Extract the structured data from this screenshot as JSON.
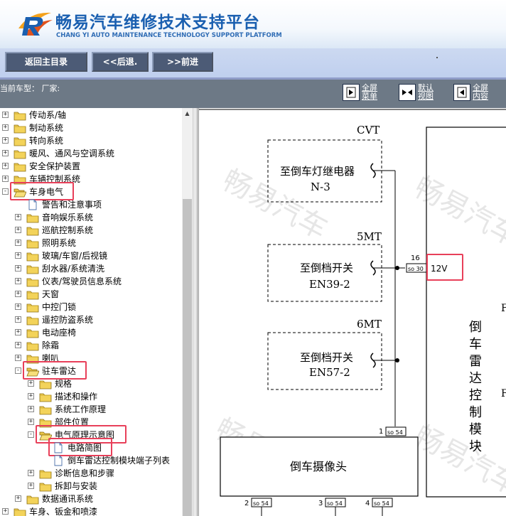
{
  "header": {
    "site_title": "畅易汽车维修技术支持平台",
    "site_subtitle": "CHANG YI AUTO MAINTENANCE TECHNOLOGY SUPPORT PLATFORM"
  },
  "toolbar": {
    "home_label": "返回主目录",
    "back_label": "<<后退.",
    "forward_label": ">>前进"
  },
  "infobar": {
    "current_model": "当前车型：  厂家:",
    "view_buttons": [
      {
        "line1": "全屏",
        "line2": "菜单"
      },
      {
        "line1": "默认",
        "line2": "视图"
      },
      {
        "line1": "全屏",
        "line2": "内容"
      }
    ]
  },
  "tree": {
    "items": [
      {
        "label": "传动系/轴",
        "depth": 0,
        "expand": "+",
        "icon": "folder-closed-icon"
      },
      {
        "label": "制动系统",
        "depth": 0,
        "expand": "+",
        "icon": "folder-closed-icon"
      },
      {
        "label": "转向系统",
        "depth": 0,
        "expand": "+",
        "icon": "folder-closed-icon"
      },
      {
        "label": "暖风、通风与空调系统",
        "depth": 0,
        "expand": "+",
        "icon": "folder-closed-icon"
      },
      {
        "label": "安全保护装置",
        "depth": 0,
        "expand": "+",
        "icon": "folder-closed-icon"
      },
      {
        "label": "车辆控制系统",
        "depth": 0,
        "expand": "+",
        "icon": "folder-closed-icon"
      },
      {
        "label": "车身电气",
        "depth": 0,
        "expand": "-",
        "icon": "folder-open-icon",
        "highlight": true
      },
      {
        "label": "警告和注意事项",
        "depth": 1,
        "expand": "",
        "icon": "document-icon"
      },
      {
        "label": "音响娱乐系统",
        "depth": 1,
        "expand": "+",
        "icon": "folder-closed-icon"
      },
      {
        "label": "巡航控制系统",
        "depth": 1,
        "expand": "+",
        "icon": "folder-closed-icon"
      },
      {
        "label": "照明系统",
        "depth": 1,
        "expand": "+",
        "icon": "folder-closed-icon"
      },
      {
        "label": "玻璃/车窗/后视镜",
        "depth": 1,
        "expand": "+",
        "icon": "folder-closed-icon"
      },
      {
        "label": "刮水器/系统清洗",
        "depth": 1,
        "expand": "+",
        "icon": "folder-closed-icon"
      },
      {
        "label": "仪表/驾驶员信息系统",
        "depth": 1,
        "expand": "+",
        "icon": "folder-closed-icon"
      },
      {
        "label": "天窗",
        "depth": 1,
        "expand": "+",
        "icon": "folder-closed-icon"
      },
      {
        "label": "中控门锁",
        "depth": 1,
        "expand": "+",
        "icon": "folder-closed-icon"
      },
      {
        "label": "遥控防盗系统",
        "depth": 1,
        "expand": "+",
        "icon": "folder-closed-icon"
      },
      {
        "label": "电动座椅",
        "depth": 1,
        "expand": "+",
        "icon": "folder-closed-icon"
      },
      {
        "label": "除霜",
        "depth": 1,
        "expand": "+",
        "icon": "folder-closed-icon"
      },
      {
        "label": "喇叭",
        "depth": 1,
        "expand": "+",
        "icon": "folder-closed-icon"
      },
      {
        "label": "驻车雷达",
        "depth": 1,
        "expand": "-",
        "icon": "folder-open-icon",
        "highlight": true
      },
      {
        "label": "规格",
        "depth": 2,
        "expand": "+",
        "icon": "folder-closed-icon"
      },
      {
        "label": "描述和操作",
        "depth": 2,
        "expand": "+",
        "icon": "folder-closed-icon"
      },
      {
        "label": "系统工作原理",
        "depth": 2,
        "expand": "+",
        "icon": "folder-closed-icon"
      },
      {
        "label": "部件位置",
        "depth": 2,
        "expand": "+",
        "icon": "folder-closed-icon"
      },
      {
        "label": "电气原理示意图",
        "depth": 2,
        "expand": "-",
        "icon": "folder-open-icon",
        "highlight": true
      },
      {
        "label": "电路简图",
        "depth": 3,
        "expand": "",
        "icon": "document-icon",
        "highlight": true
      },
      {
        "label": "倒车雷达控制模块端子列表",
        "depth": 3,
        "expand": "",
        "icon": "document-icon"
      },
      {
        "label": "诊断信息和步骤",
        "depth": 2,
        "expand": "+",
        "icon": "folder-closed-icon"
      },
      {
        "label": "拆卸与安装",
        "depth": 2,
        "expand": "+",
        "icon": "folder-closed-icon"
      },
      {
        "label": "数据通讯系统",
        "depth": 1,
        "expand": "+",
        "icon": "folder-closed-icon"
      },
      {
        "label": "车身、钣金和喷漆",
        "depth": 0,
        "expand": "+",
        "icon": "folder-closed-icon"
      }
    ]
  },
  "diagram": {
    "watermark": "畅易汽车",
    "labels": {
      "cvt": "CVT",
      "relay_line1": "至倒车灯继电器",
      "relay_line2": "N-3",
      "mt5": "5MT",
      "sw5_line1": "至倒档开关",
      "sw5_line2": "EN39-2",
      "pin16": "16",
      "so30": "so 30",
      "volt12": "12V",
      "mt6": "6MT",
      "sw6_line1": "至倒档开关",
      "sw6_line2": "EN57-2",
      "module_chars": [
        "倒",
        "车",
        "雷",
        "达",
        "控",
        "制",
        "模",
        "块"
      ],
      "pin1": "1",
      "so54": "so 54",
      "camera": "倒车摄像头",
      "pin2": "2",
      "pin3": "3",
      "pin4": "4",
      "edge_f1": "F",
      "edge_f2": "F"
    }
  },
  "colors": {
    "brand_blue": "#1a5fb0",
    "button_bg": "#4c5b76",
    "toolbar_bg": "#c6d4ef",
    "infobar_bg": "#6d7986",
    "highlight_red": "#e8405a"
  }
}
